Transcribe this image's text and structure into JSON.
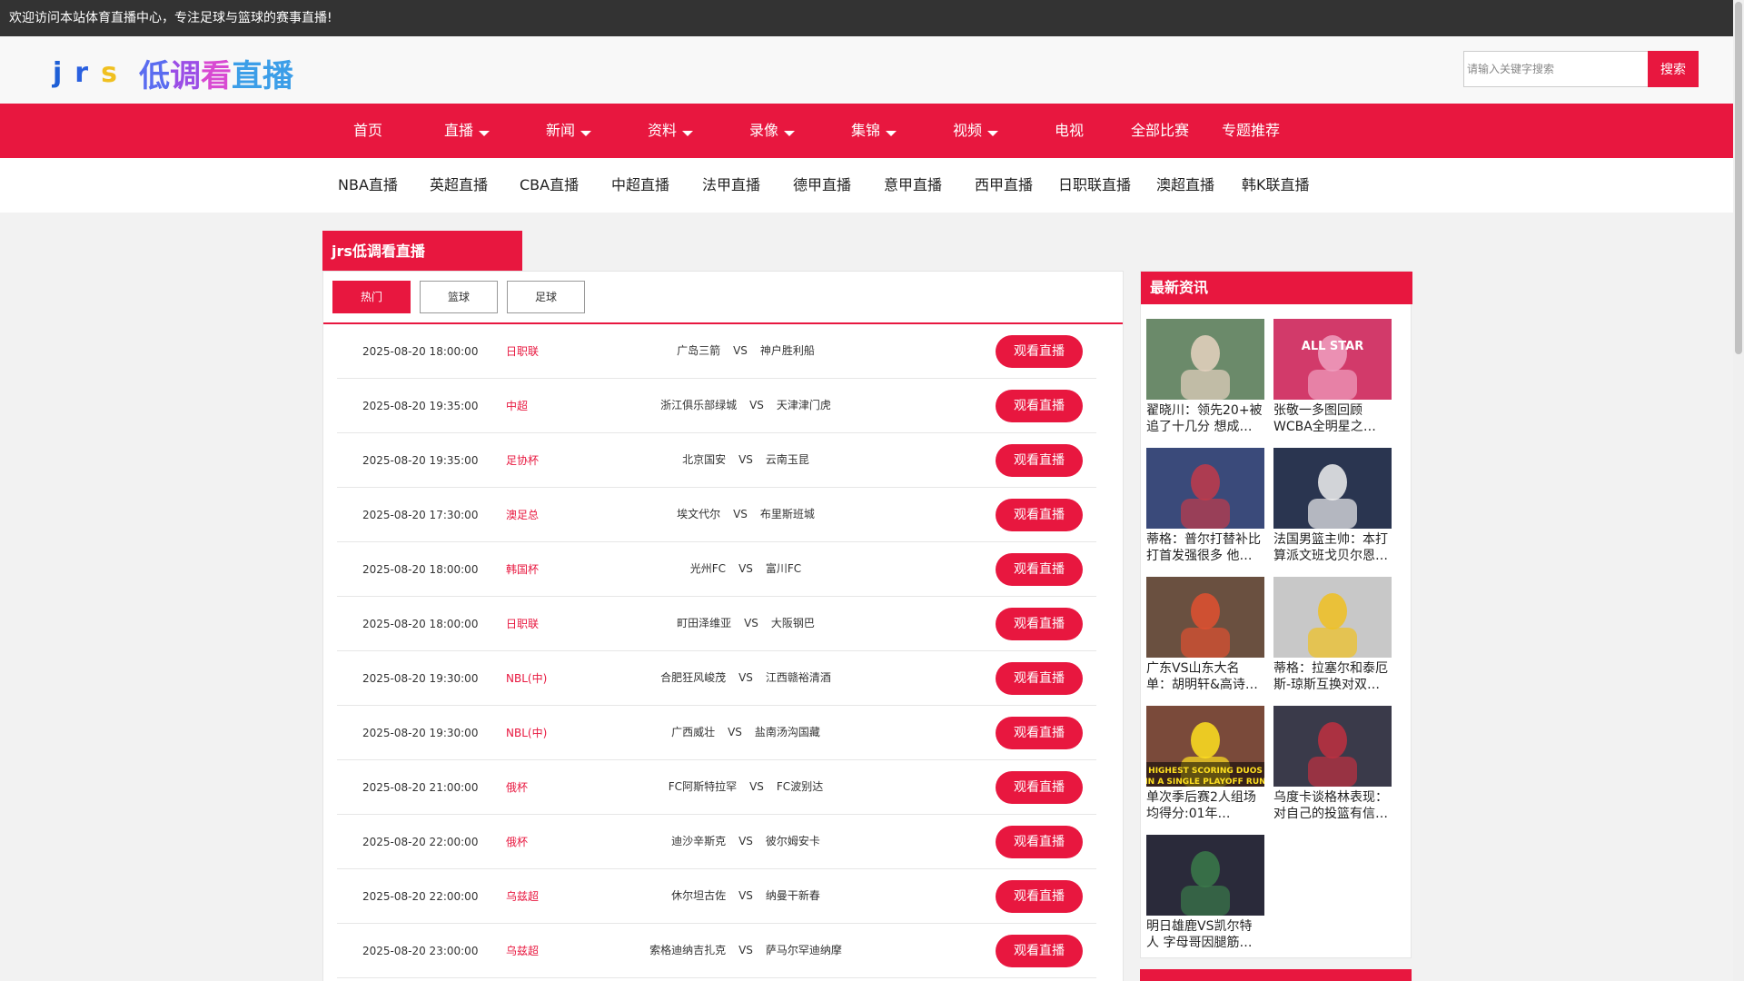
{
  "topbar": {
    "welcome": "欢迎访问本站体育直播中心，专注足球与篮球的赛事直播!"
  },
  "header": {
    "logo_letters": [
      "j",
      "r",
      "s"
    ],
    "logo_chars": [
      "低",
      "调",
      "看",
      "直播"
    ],
    "search": {
      "placeholder": "请输入关键字搜索",
      "value": "",
      "button": "搜索"
    }
  },
  "mainnav": [
    {
      "label": "首页",
      "dropdown": false
    },
    {
      "label": "直播",
      "dropdown": true
    },
    {
      "label": "新闻",
      "dropdown": true
    },
    {
      "label": "资料",
      "dropdown": true
    },
    {
      "label": "录像",
      "dropdown": true
    },
    {
      "label": "集锦",
      "dropdown": true
    },
    {
      "label": "视频",
      "dropdown": true
    },
    {
      "label": "电视",
      "dropdown": false
    },
    {
      "label": "全部比赛",
      "dropdown": false
    },
    {
      "label": "专题推荐",
      "dropdown": false
    }
  ],
  "subnav": [
    "NBA直播",
    "英超直播",
    "CBA直播",
    "中超直播",
    "法甲直播",
    "德甲直播",
    "意甲直播",
    "西甲直播",
    "日职联直播",
    "澳超直播",
    "韩K联直播"
  ],
  "section": {
    "title": "jrs低调看直播",
    "tabs": [
      {
        "label": "热门",
        "active": true
      },
      {
        "label": "篮球",
        "active": false
      },
      {
        "label": "足球",
        "active": false
      }
    ],
    "vs_label": "VS",
    "watch_label": "观看直播",
    "matches": [
      {
        "time": "2025-08-20 18:00:00",
        "league": "日职联",
        "home": "广岛三箭",
        "away": "神户胜利船"
      },
      {
        "time": "2025-08-20 19:35:00",
        "league": "中超",
        "home": "浙江俱乐部绿城",
        "away": "天津津门虎"
      },
      {
        "time": "2025-08-20 19:35:00",
        "league": "足协杯",
        "home": "北京国安",
        "away": "云南玉昆"
      },
      {
        "time": "2025-08-20 17:30:00",
        "league": "澳足总",
        "home": "埃文代尔",
        "away": "布里斯班城"
      },
      {
        "time": "2025-08-20 18:00:00",
        "league": "韩国杯",
        "home": "光州FC",
        "away": "富川FC"
      },
      {
        "time": "2025-08-20 18:00:00",
        "league": "日职联",
        "home": "町田泽维亚",
        "away": "大阪钢巴"
      },
      {
        "time": "2025-08-20 19:30:00",
        "league": "NBL(中)",
        "home": "合肥狂风峻茂",
        "away": "江西赣裕清酒"
      },
      {
        "time": "2025-08-20 19:30:00",
        "league": "NBL(中)",
        "home": "广西威壮",
        "away": "盐南汤沟国藏"
      },
      {
        "time": "2025-08-20 21:00:00",
        "league": "俄杯",
        "home": "FC阿斯特拉罕",
        "away": "FC波别达"
      },
      {
        "time": "2025-08-20 22:00:00",
        "league": "俄杯",
        "home": "迪沙辛斯克",
        "away": "彼尔姆安卡"
      },
      {
        "time": "2025-08-20 22:00:00",
        "league": "乌兹超",
        "home": "休尔坦古佐",
        "away": "纳曼干新春"
      },
      {
        "time": "2025-08-20 23:00:00",
        "league": "乌兹超",
        "home": "索格迪纳吉扎克",
        "away": "萨马尔罕迪纳摩"
      }
    ]
  },
  "news": {
    "title": "最新资讯",
    "items": [
      {
        "caption": "翟晓川：领先20+被追了十几分 想成强…"
      },
      {
        "caption": "张敬一多图回顾WCBA全明星之旅：…"
      },
      {
        "caption": "蒂格：普尔打替补比打首发强很多 他将…"
      },
      {
        "caption": "法国男篮主帅：本打算派文班戈贝尔恩…"
      },
      {
        "caption": "广东VS山东大名单：胡明轩&高诗…"
      },
      {
        "caption": "蒂格：拉塞尔和泰厄斯-琼斯互换对双…"
      },
      {
        "caption": "单次季后赛2人组场均得分:01年OK59.…"
      },
      {
        "caption": "乌度卡谈格林表现：对自己的投篮有信…"
      },
      {
        "caption": "明日雄鹿VS凯尔特人 字母哥因腿筋伤…"
      }
    ],
    "thumb_texts": [
      "ALL STAR",
      "HIGHEST SCORING DUOS",
      "IN A SINGLE PLAYOFF RUN"
    ]
  }
}
